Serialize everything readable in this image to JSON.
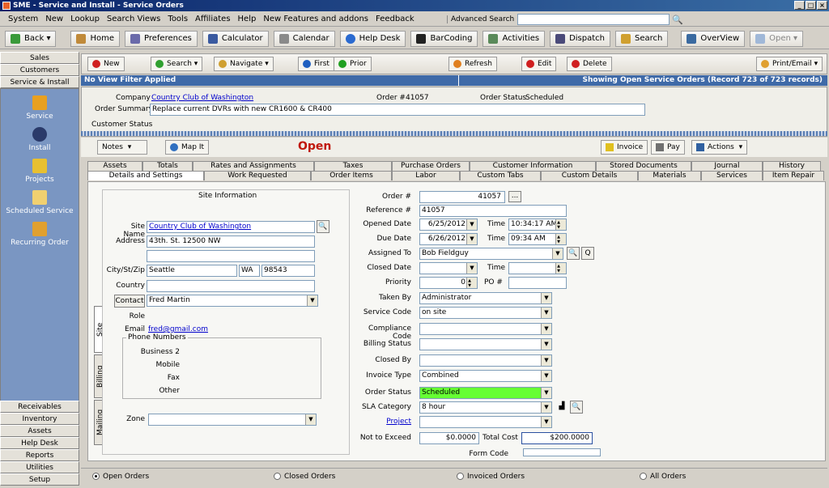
{
  "window": {
    "title": "SME - Service and Install - Service Orders"
  },
  "menu": [
    "System",
    "New",
    "Lookup",
    "Search Views",
    "Tools",
    "Affiliates",
    "Help",
    "New Features and addons",
    "Feedback"
  ],
  "advanced_search": {
    "label": "Advanced Search",
    "value": ""
  },
  "toolbar": {
    "back": "Back",
    "home": "Home",
    "preferences": "Preferences",
    "calculator": "Calculator",
    "calendar": "Calendar",
    "help_desk": "Help Desk",
    "barcoding": "BarCoding",
    "activities": "Activities",
    "dispatch": "Dispatch",
    "search": "Search",
    "overview": "OverView",
    "open": "Open"
  },
  "sidebar": {
    "top": [
      "Sales",
      "Customers",
      "Service & Install"
    ],
    "panel": [
      "Service",
      "Install",
      "Projects",
      "Scheduled Service",
      "Recurring Order"
    ],
    "bottom": [
      "Receivables",
      "Inventory",
      "Assets",
      "Help Desk",
      "Reports",
      "Utilities",
      "Setup"
    ]
  },
  "toolbar2": {
    "new": "New",
    "search": "Search",
    "navigate": "Navigate",
    "first": "First",
    "prior": "Prior",
    "refresh": "Refresh",
    "edit": "Edit",
    "delete": "Delete",
    "print": "Print/Email"
  },
  "filter": {
    "left": "No View Filter Applied",
    "right": "Showing Open Service Orders   (Record 723 of 723 records)"
  },
  "summary": {
    "company_label": "Company",
    "company": "Country Club of Washington",
    "order_label": "Order #",
    "order": "41057",
    "status_label": "Order Status",
    "status": "Scheduled",
    "summary_label": "Order Summary",
    "summary": "Replace current DVRs with new CR1600 & CR400",
    "customer_status_label": "Customer Status"
  },
  "header2": {
    "notes": "Notes",
    "map": "Map It",
    "open": "Open",
    "invoice": "Invoice",
    "pay": "Pay",
    "actions": "Actions"
  },
  "tabs_top": [
    "Assets",
    "Totals",
    "Rates and Assignments",
    "Taxes",
    "Purchase Orders",
    "Customer Information",
    "Stored Documents",
    "Journal",
    "History"
  ],
  "tabs_bottom": [
    "Details and Settings",
    "Work Requested",
    "Order Items",
    "Labor",
    "Custom Tabs",
    "Custom Details",
    "Materials",
    "Services",
    "Item Repair"
  ],
  "vtabs": [
    "Site",
    "Billing",
    "Mailing"
  ],
  "site": {
    "heading": "Site Information",
    "site_name_label": "Site Name",
    "site_name": "Country Club of Washington",
    "address_label": "Address",
    "address": "43th. St. 12500 NW",
    "address2": "",
    "city_label": "City/St/Zip",
    "city": "Seattle",
    "state": "WA",
    "zip": "98543",
    "country_label": "Country",
    "country": "",
    "contact_label": "Contact",
    "contact": "Fred Martin",
    "role_label": "Role",
    "email_label": "Email",
    "email": "fred@gmail.com",
    "phone_heading": "Phone Numbers",
    "business2": "Business 2",
    "mobile": "Mobile",
    "fax": "Fax",
    "other": "Other",
    "zone_label": "Zone",
    "zone": ""
  },
  "order": {
    "order_no_label": "Order #",
    "order_no": "41057",
    "reference_label": "Reference #",
    "reference": "41057",
    "opened_label": "Opened Date",
    "opened": "6/25/2012",
    "time_label": "Time",
    "opened_time": "10:34:17 AM",
    "due_label": "Due Date",
    "due": "6/26/2012",
    "due_time": "09:34 AM",
    "assigned_label": "Assigned To",
    "assigned": "Bob Fieldguy",
    "closed_label": "Closed Date",
    "closed": "",
    "closed_time": "",
    "priority_label": "Priority",
    "priority": "0",
    "po_label": "PO #",
    "po": "",
    "taken_label": "Taken By",
    "taken": "Administrator",
    "service_code_label": "Service Code",
    "service_code": "on site",
    "compliance_label": "Compliance Code",
    "compliance": "",
    "billing_label": "Billing Status",
    "billing": "",
    "closed_by_label": "Closed By",
    "closed_by": "",
    "invoice_type_label": "Invoice Type",
    "invoice_type": "Combined",
    "order_status_label": "Order Status",
    "order_status": "Scheduled",
    "sla_label": "SLA Category",
    "sla": "8 hour",
    "project_label": "Project",
    "project": "",
    "nte_label": "Not to Exceed",
    "nte": "$0.0000",
    "total_label": "Total Cost",
    "total": "$200.0000",
    "form_code_label": "Form Code"
  },
  "bottom": {
    "open": "Open Orders",
    "closed": "Closed Orders",
    "invoiced": "Invoiced Orders",
    "all": "All Orders"
  }
}
